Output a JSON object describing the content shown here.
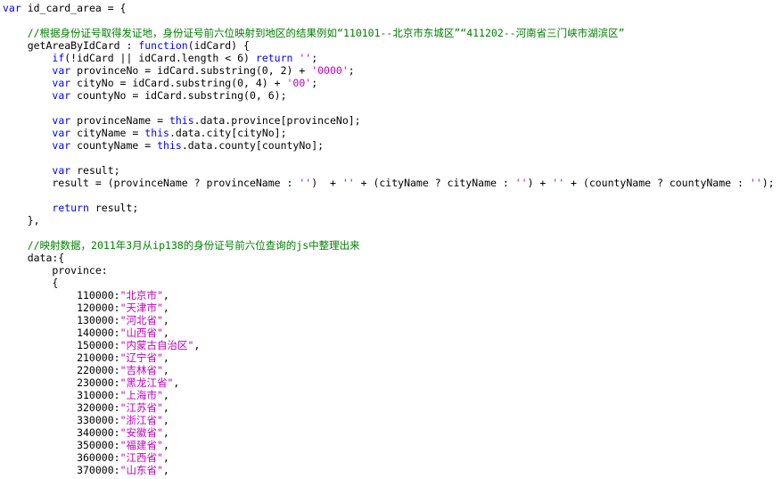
{
  "colors": {
    "background": "#ffffff",
    "keyword": "#0000ff",
    "comment": "#008000",
    "string": "#c000c0",
    "plain": "#000000"
  },
  "code_lines": [
    [
      {
        "t": "kw",
        "v": "var"
      },
      {
        "t": "pl",
        "v": " id_card_area = {"
      }
    ],
    [],
    [
      {
        "t": "pl",
        "v": "    "
      },
      {
        "t": "cm",
        "v": "//根据身份证号取得发证地，身份证号前六位映射到地区的结果例如“110101--北京市东城区”“411202--河南省三门峡市湖滨区”"
      }
    ],
    [
      {
        "t": "pl",
        "v": "    getAreaByIdCard : "
      },
      {
        "t": "kw",
        "v": "function"
      },
      {
        "t": "pl",
        "v": "(idCard) {"
      }
    ],
    [
      {
        "t": "pl",
        "v": "        "
      },
      {
        "t": "kw",
        "v": "if"
      },
      {
        "t": "pl",
        "v": "(!idCard || idCard.length < 6) "
      },
      {
        "t": "kw",
        "v": "return"
      },
      {
        "t": "pl",
        "v": " "
      },
      {
        "t": "st",
        "v": "''"
      },
      {
        "t": "pl",
        "v": ";"
      }
    ],
    [
      {
        "t": "pl",
        "v": "        "
      },
      {
        "t": "kw",
        "v": "var"
      },
      {
        "t": "pl",
        "v": " provinceNo = idCard.substring(0, 2) + "
      },
      {
        "t": "st",
        "v": "'0000'"
      },
      {
        "t": "pl",
        "v": ";"
      }
    ],
    [
      {
        "t": "pl",
        "v": "        "
      },
      {
        "t": "kw",
        "v": "var"
      },
      {
        "t": "pl",
        "v": " cityNo = idCard.substring(0, 4) + "
      },
      {
        "t": "st",
        "v": "'00'"
      },
      {
        "t": "pl",
        "v": ";"
      }
    ],
    [
      {
        "t": "pl",
        "v": "        "
      },
      {
        "t": "kw",
        "v": "var"
      },
      {
        "t": "pl",
        "v": " countyNo = idCard.substring(0, 6);"
      }
    ],
    [],
    [
      {
        "t": "pl",
        "v": "        "
      },
      {
        "t": "kw",
        "v": "var"
      },
      {
        "t": "pl",
        "v": " provinceName = "
      },
      {
        "t": "kw",
        "v": "this"
      },
      {
        "t": "pl",
        "v": ".data.province[provinceNo];"
      }
    ],
    [
      {
        "t": "pl",
        "v": "        "
      },
      {
        "t": "kw",
        "v": "var"
      },
      {
        "t": "pl",
        "v": " cityName = "
      },
      {
        "t": "kw",
        "v": "this"
      },
      {
        "t": "pl",
        "v": ".data.city[cityNo];"
      }
    ],
    [
      {
        "t": "pl",
        "v": "        "
      },
      {
        "t": "kw",
        "v": "var"
      },
      {
        "t": "pl",
        "v": " countyName = "
      },
      {
        "t": "kw",
        "v": "this"
      },
      {
        "t": "pl",
        "v": ".data.county[countyNo];"
      }
    ],
    [],
    [
      {
        "t": "pl",
        "v": "        "
      },
      {
        "t": "kw",
        "v": "var"
      },
      {
        "t": "pl",
        "v": " result;"
      }
    ],
    [
      {
        "t": "pl",
        "v": "        result = (provinceName ? provinceName : "
      },
      {
        "t": "st",
        "v": "''"
      },
      {
        "t": "pl",
        "v": ")  + "
      },
      {
        "t": "st",
        "v": "''"
      },
      {
        "t": "pl",
        "v": " + (cityName ? cityName : "
      },
      {
        "t": "st",
        "v": "''"
      },
      {
        "t": "pl",
        "v": ") + "
      },
      {
        "t": "st",
        "v": "''"
      },
      {
        "t": "pl",
        "v": " + (countyName ? countyName : "
      },
      {
        "t": "st",
        "v": "''"
      },
      {
        "t": "pl",
        "v": ");"
      }
    ],
    [],
    [
      {
        "t": "pl",
        "v": "        "
      },
      {
        "t": "kw",
        "v": "return"
      },
      {
        "t": "pl",
        "v": " result;"
      }
    ],
    [
      {
        "t": "pl",
        "v": "    },"
      }
    ],
    [],
    [
      {
        "t": "pl",
        "v": "    "
      },
      {
        "t": "cm",
        "v": "//映射数据，2011年3月从ip138的身份证号前六位查询的js中整理出来"
      }
    ],
    [
      {
        "t": "pl",
        "v": "    data:{"
      }
    ],
    [
      {
        "t": "pl",
        "v": "        province:"
      }
    ],
    [
      {
        "t": "pl",
        "v": "        {"
      }
    ],
    [
      {
        "t": "pl",
        "v": "            110000:"
      },
      {
        "t": "st",
        "v": "\"北京市\""
      },
      {
        "t": "pl",
        "v": ","
      }
    ],
    [
      {
        "t": "pl",
        "v": "            120000:"
      },
      {
        "t": "st",
        "v": "\"天津市\""
      },
      {
        "t": "pl",
        "v": ","
      }
    ],
    [
      {
        "t": "pl",
        "v": "            130000:"
      },
      {
        "t": "st",
        "v": "\"河北省\""
      },
      {
        "t": "pl",
        "v": ","
      }
    ],
    [
      {
        "t": "pl",
        "v": "            140000:"
      },
      {
        "t": "st",
        "v": "\"山西省\""
      },
      {
        "t": "pl",
        "v": ","
      }
    ],
    [
      {
        "t": "pl",
        "v": "            150000:"
      },
      {
        "t": "st",
        "v": "\"内蒙古自治区\""
      },
      {
        "t": "pl",
        "v": ","
      }
    ],
    [
      {
        "t": "pl",
        "v": "            210000:"
      },
      {
        "t": "st",
        "v": "\"辽宁省\""
      },
      {
        "t": "pl",
        "v": ","
      }
    ],
    [
      {
        "t": "pl",
        "v": "            220000:"
      },
      {
        "t": "st",
        "v": "\"吉林省\""
      },
      {
        "t": "pl",
        "v": ","
      }
    ],
    [
      {
        "t": "pl",
        "v": "            230000:"
      },
      {
        "t": "st",
        "v": "\"黑龙江省\""
      },
      {
        "t": "pl",
        "v": ","
      }
    ],
    [
      {
        "t": "pl",
        "v": "            310000:"
      },
      {
        "t": "st",
        "v": "\"上海市\""
      },
      {
        "t": "pl",
        "v": ","
      }
    ],
    [
      {
        "t": "pl",
        "v": "            320000:"
      },
      {
        "t": "st",
        "v": "\"江苏省\""
      },
      {
        "t": "pl",
        "v": ","
      }
    ],
    [
      {
        "t": "pl",
        "v": "            330000:"
      },
      {
        "t": "st",
        "v": "\"浙江省\""
      },
      {
        "t": "pl",
        "v": ","
      }
    ],
    [
      {
        "t": "pl",
        "v": "            340000:"
      },
      {
        "t": "st",
        "v": "\"安徽省\""
      },
      {
        "t": "pl",
        "v": ","
      }
    ],
    [
      {
        "t": "pl",
        "v": "            350000:"
      },
      {
        "t": "st",
        "v": "\"福建省\""
      },
      {
        "t": "pl",
        "v": ","
      }
    ],
    [
      {
        "t": "pl",
        "v": "            360000:"
      },
      {
        "t": "st",
        "v": "\"江西省\""
      },
      {
        "t": "pl",
        "v": ","
      }
    ],
    [
      {
        "t": "pl",
        "v": "            370000:"
      },
      {
        "t": "st",
        "v": "\"山东省\""
      },
      {
        "t": "pl",
        "v": ","
      }
    ]
  ]
}
